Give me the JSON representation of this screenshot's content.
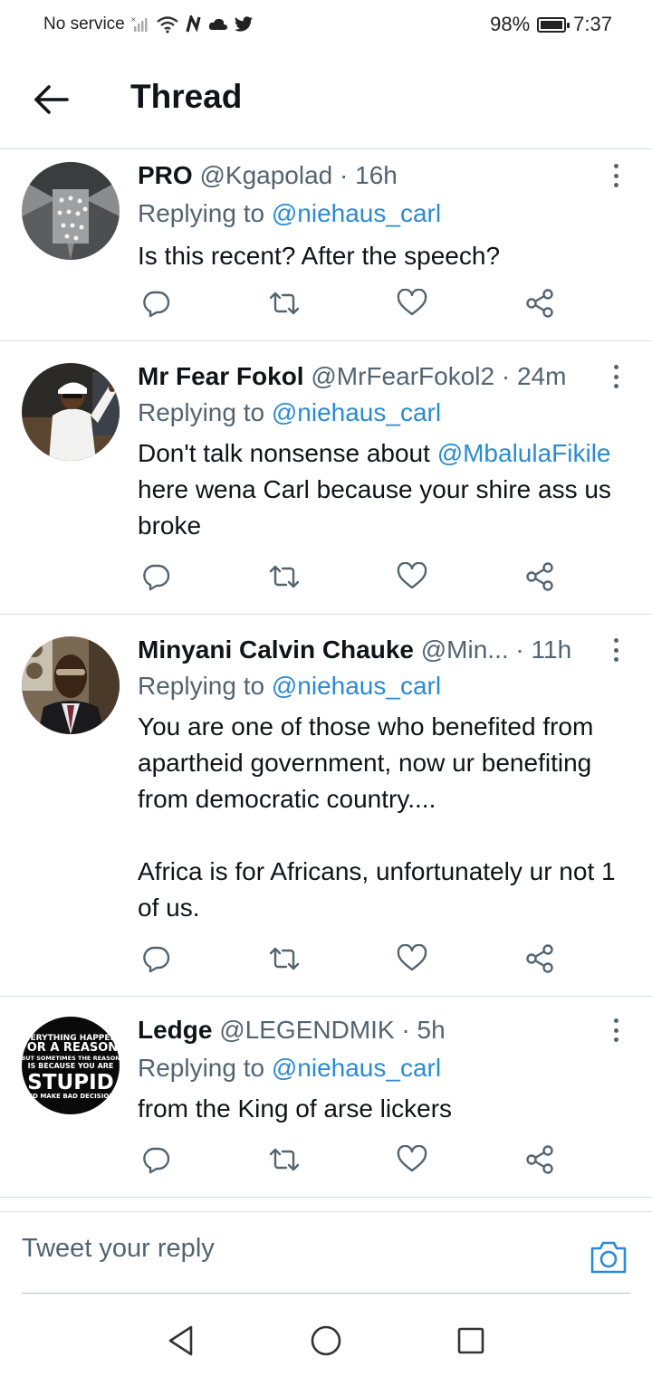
{
  "status_bar": {
    "carrier": "No service",
    "battery": "98%",
    "time": "7:37",
    "icons": [
      "signal-off-icon",
      "wifi-icon",
      "n-icon",
      "cloud-icon",
      "twitter-bird-icon"
    ],
    "battery_level": 0.98
  },
  "header": {
    "title": "Thread",
    "back_icon": "arrow-left-icon"
  },
  "tweets": [
    {
      "name": "PRO",
      "handle": "@Kgapolad",
      "sep": "·",
      "time": "16h",
      "replying_prefix": "Replying to ",
      "replying_to": "@niehaus_carl",
      "text": "Is this recent? After the speech?"
    },
    {
      "name": "Mr Fear Fokol",
      "handle": "@MrFearFokol2",
      "sep": "·",
      "time": "24m",
      "replying_prefix": "Replying to ",
      "replying_to": "@niehaus_carl",
      "text_before": "Don't talk nonsense about ",
      "text_mention": "@MbalulaFikile",
      "text_after": " here wena Carl because your shire ass us broke"
    },
    {
      "name": "Minyani Calvin Chauke",
      "handle": "@Min...",
      "sep": "·",
      "time": "11h",
      "replying_prefix": "Replying to ",
      "replying_to": "@niehaus_carl",
      "text_p1": "You are one of those who benefited from apartheid government, now ur benefiting from democratic country....",
      "text_p2": "Africa is for Africans, unfortunately ur not 1 of us."
    },
    {
      "name": "Ledge",
      "handle": "@LEGENDMIK",
      "sep": "·",
      "time": "5h",
      "replying_prefix": "Replying to ",
      "replying_to": "@niehaus_carl",
      "text": "from the King of arse lickers",
      "avatar_text": [
        "EVERYTHING HAPPENS",
        "FOR A REASON.",
        "BUT SOMETIMES THE REASON",
        "IS BECAUSE YOU ARE",
        "STUPID",
        "AND MAKE BAD DECISIONS"
      ]
    }
  ],
  "reply_bar": {
    "placeholder": "Tweet your reply",
    "camera_icon": "camera-icon"
  },
  "nav": {
    "icons": [
      "back-triangle-icon",
      "home-circle-icon",
      "recents-square-icon"
    ]
  },
  "colors": {
    "text": "#0f1419",
    "secondary": "#536471",
    "accent": "#2b8bd0",
    "divider": "#d9dde0"
  }
}
